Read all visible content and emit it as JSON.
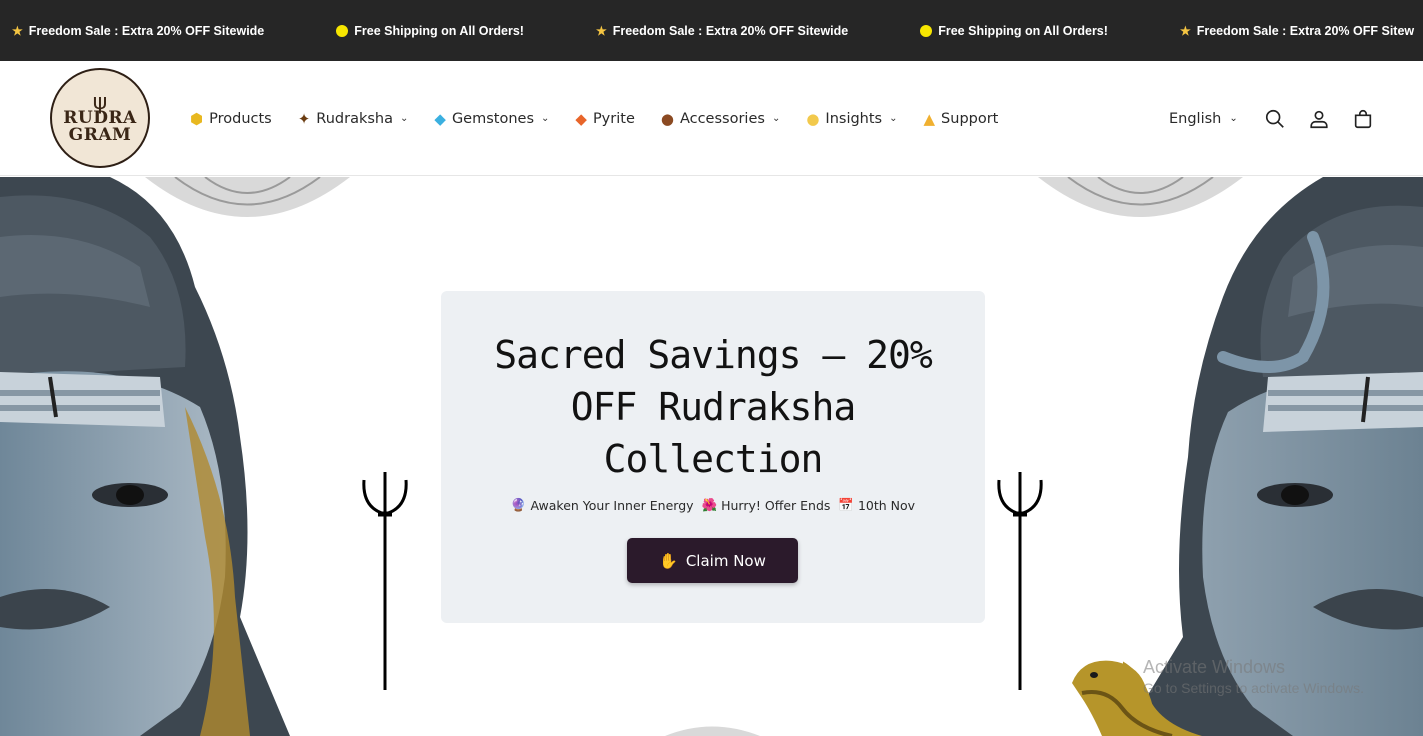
{
  "announcement": {
    "items": [
      {
        "icon": "star-icon",
        "text": "Freedom Sale : Extra 20% OFF Sitewide"
      },
      {
        "icon": "yellow-circle-icon",
        "text": "Free Shipping on All Orders!"
      },
      {
        "icon": "star-icon",
        "text": "Freedom Sale : Extra 20% OFF Sitewide"
      },
      {
        "icon": "yellow-circle-icon",
        "text": "Free Shipping on All Orders!"
      },
      {
        "icon": "star-icon",
        "text": "Freedom Sale : Extra 20% OFF Sitew"
      }
    ]
  },
  "header": {
    "logo": {
      "line1": "RUDRA",
      "line2": "GRAM"
    },
    "nav": [
      {
        "label": "Products",
        "icon": "hexagon-gem-icon",
        "glyph": "⬢",
        "color": "#e8b820",
        "dropdown": false
      },
      {
        "label": "Rudraksha",
        "icon": "rudraksha-bead-icon",
        "glyph": "✦",
        "color": "#6b3d12",
        "dropdown": true
      },
      {
        "label": "Gemstones",
        "icon": "gem-icon",
        "glyph": "◆",
        "color": "#3bb0e0",
        "dropdown": true
      },
      {
        "label": "Pyrite",
        "icon": "orange-diamond-icon",
        "glyph": "◆",
        "color": "#e8652a",
        "dropdown": false
      },
      {
        "label": "Accessories",
        "icon": "bowl-icon",
        "glyph": "●",
        "color": "#8b4a22",
        "dropdown": true
      },
      {
        "label": "Insights",
        "icon": "lightbulb-icon",
        "glyph": "●",
        "color": "#f2c94c",
        "dropdown": true
      },
      {
        "label": "Support",
        "icon": "folded-hands-icon",
        "glyph": "▲",
        "color": "#f0b030",
        "dropdown": false
      }
    ],
    "language": "English"
  },
  "hero": {
    "title": "Sacred Savings – 20% OFF Rudraksha Collection",
    "subtitle": [
      {
        "icon": "crystal-ball-icon",
        "text": "Awaken Your Inner Energy"
      },
      {
        "icon": "flower-icon",
        "text": "Hurry! Offer Ends"
      },
      {
        "icon": "calendar-icon",
        "text": "10th Nov"
      }
    ],
    "cta": "Claim Now"
  },
  "watermark": {
    "line1": "Activate Windows",
    "line2": "Go to Settings to activate Windows."
  },
  "colors": {
    "announcement_bg": "#262626",
    "promo_bg": "#edf0f3",
    "cta_bg": "#2b1a2b"
  }
}
